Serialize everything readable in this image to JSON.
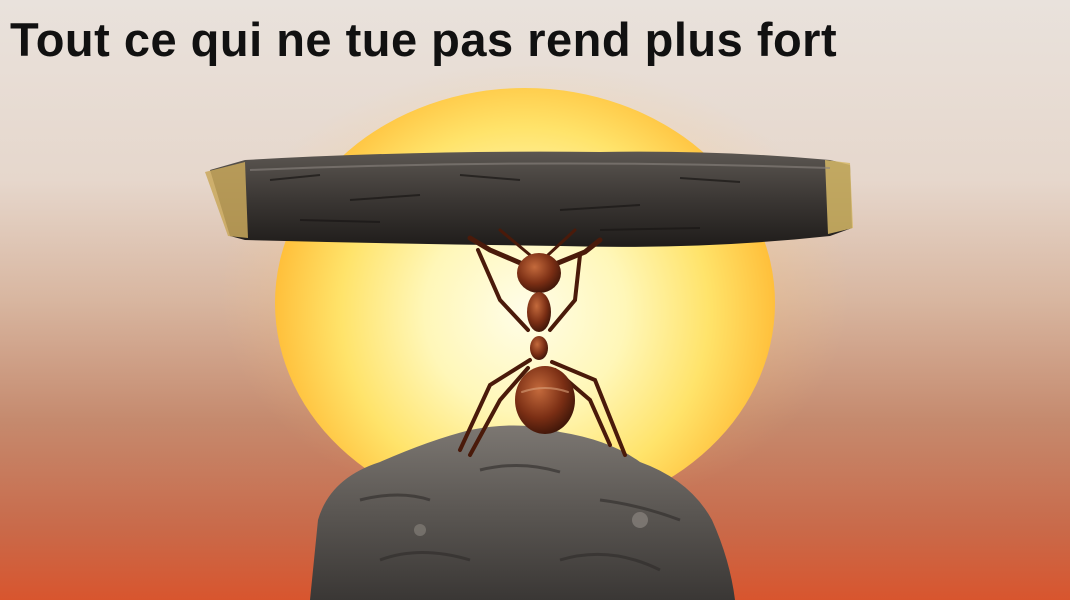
{
  "caption": "Tout ce qui ne tue pas rend plus fort",
  "colors": {
    "sky_top": "#e9e2dc",
    "horizon": "#d8552e",
    "sun_core": "#fff7b8",
    "sun_edge": "#f4892a",
    "stick": "#3a3633",
    "ant": "#7a2e14",
    "rock": "#5e5a56",
    "caption_text": "#111111"
  },
  "icons": [
    "sun",
    "stick",
    "ant",
    "rock"
  ]
}
